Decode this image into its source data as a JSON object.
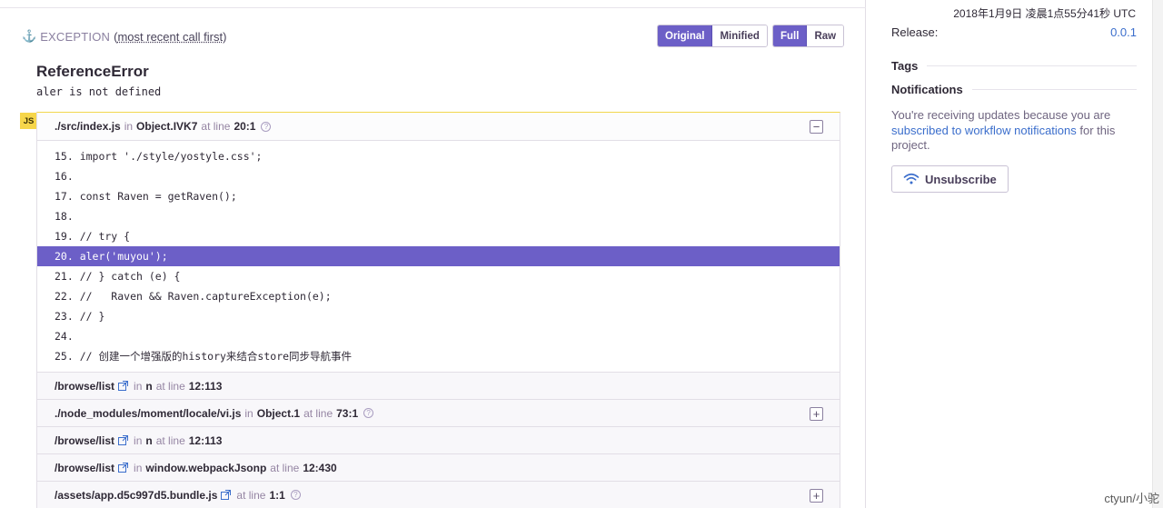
{
  "exception": {
    "anchor_icon": "anchor-icon",
    "title": "EXCEPTION",
    "subtitle_open": "(",
    "subtitle_link": "most recent call first",
    "subtitle_close": ")",
    "buttons_a": [
      "Original",
      "Minified"
    ],
    "buttons_b": [
      "Full",
      "Raw"
    ],
    "error_type": "ReferenceError",
    "error_message": "aler is not defined",
    "platform_badge": "JS"
  },
  "frames": [
    {
      "file": "./src/index.js",
      "in_label": "in",
      "function": "Object.IVK7",
      "at_label": "at line",
      "line": "20:1",
      "toggle": "−",
      "code": [
        {
          "text": "15. import './style/yostyle.css';",
          "active": false
        },
        {
          "text": "16.",
          "active": false
        },
        {
          "text": "17. const Raven = getRaven();",
          "active": false
        },
        {
          "text": "18.",
          "active": false
        },
        {
          "text": "19. // try {",
          "active": false
        },
        {
          "text": "20. aler('muyou');",
          "active": true
        },
        {
          "text": "21. // } catch (e) {",
          "active": false
        },
        {
          "text": "22. //   Raven && Raven.captureException(e);",
          "active": false
        },
        {
          "text": "23. // }",
          "active": false
        },
        {
          "text": "24.",
          "active": false
        },
        {
          "text": "25. // 创建一个增强版的history来结合store同步导航事件",
          "active": false
        }
      ]
    },
    {
      "file": "/browse/list",
      "in_label": "in",
      "function": "n",
      "at_label": "at line",
      "line": "12:113"
    },
    {
      "file": "./node_modules/moment/locale/vi.js",
      "in_label": "in",
      "function": "Object.1",
      "at_label": "at line",
      "line": "73:1",
      "toggle": "+"
    },
    {
      "file": "/browse/list",
      "in_label": "in",
      "function": "n",
      "at_label": "at line",
      "line": "12:113"
    },
    {
      "file": "/browse/list",
      "in_label": "in",
      "function": "window.webpackJsonp",
      "at_label": "at line",
      "line": "12:430"
    },
    {
      "file": "/assets/app.d5c997d5.bundle.js",
      "at_label": "at line",
      "line": "1:1",
      "toggle": "+"
    }
  ],
  "sidebar": {
    "date": "2018年1月9日 凌晨1点55分41秒 UTC",
    "release_label": "Release:",
    "release_value": "0.0.1",
    "tags_label": "Tags",
    "notifications_label": "Notifications",
    "notif_text_1": "You're receiving updates because you are ",
    "notif_link": "subscribed to workflow notifications",
    "notif_text_2": " for this project.",
    "unsubscribe_label": "Unsubscribe"
  },
  "watermark": "ctyun/小驼",
  "colors": {
    "accent": "#6c5fc7",
    "badge": "#f6d64a",
    "link": "#3b6ecc"
  }
}
